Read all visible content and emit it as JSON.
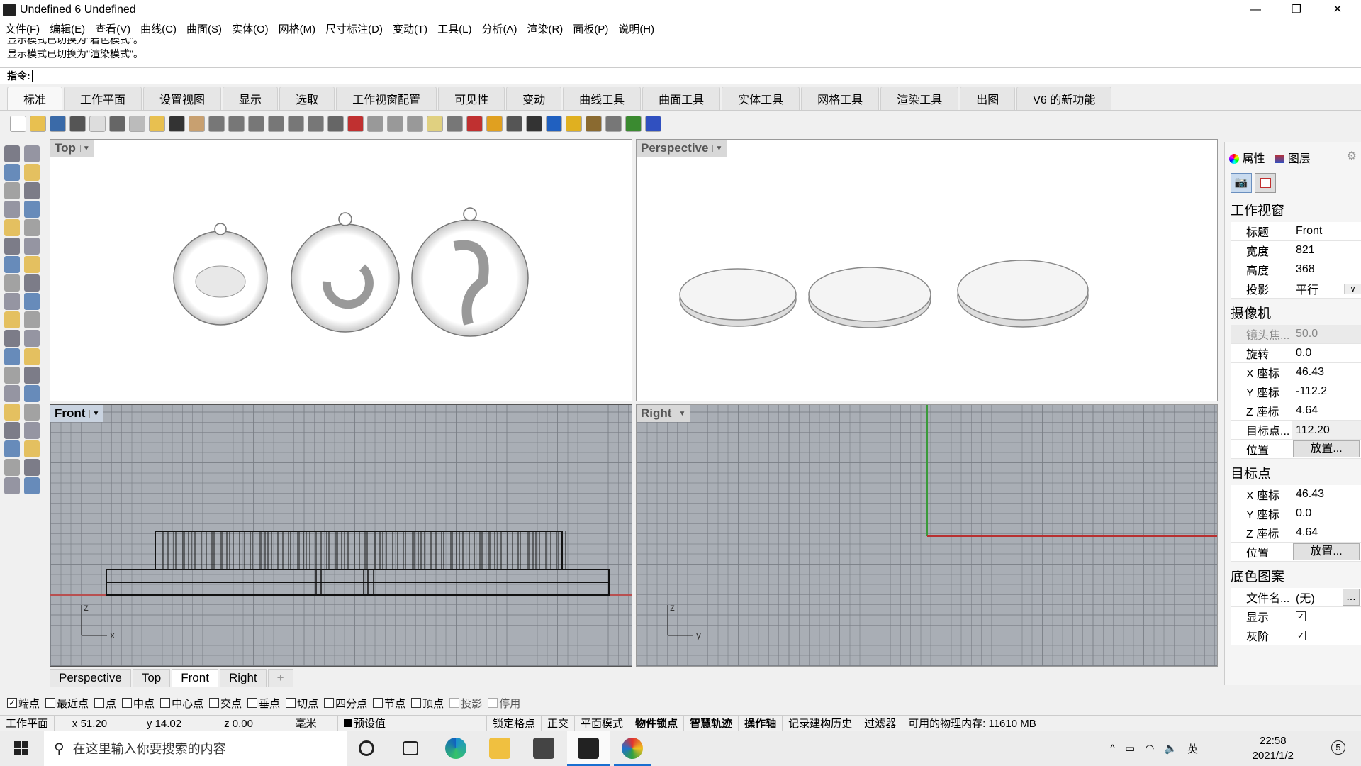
{
  "window": {
    "title": "Undefined 6 Undefined",
    "minimize": "—",
    "restore": "❐",
    "close": "✕"
  },
  "menu": [
    "文件(F)",
    "编辑(E)",
    "查看(V)",
    "曲线(C)",
    "曲面(S)",
    "实体(O)",
    "网格(M)",
    "尺寸标注(D)",
    "变动(T)",
    "工具(L)",
    "分析(A)",
    "渲染(R)",
    "面板(P)",
    "说明(H)"
  ],
  "history": [
    "显示模式已切换为\"着色模式\"。",
    "显示模式已切换为\"渲染模式\"。"
  ],
  "command": {
    "label": "指令:",
    "value": ""
  },
  "tabs": [
    "标准",
    "工作平面",
    "设置视图",
    "显示",
    "选取",
    "工作视窗配置",
    "可见性",
    "变动",
    "曲线工具",
    "曲面工具",
    "实体工具",
    "网格工具",
    "渲染工具",
    "出图",
    "V6 的新功能"
  ],
  "toolbar_colors": [
    "#ffffff",
    "#e8c050",
    "#3a6aa8",
    "#555",
    "#ddd",
    "#666",
    "#bbb",
    "#e8c050",
    "#333",
    "#c8a070",
    "#777",
    "#777",
    "#777",
    "#777",
    "#777",
    "#777",
    "#666",
    "#c03030",
    "#999",
    "#999",
    "#999",
    "#e0d080",
    "#777",
    "#c03030",
    "#e0a020",
    "#555",
    "#333",
    "#2060c0",
    "#e0b020",
    "#8a6a30",
    "#777",
    "#3a8a30",
    "#3050c0"
  ],
  "viewports": {
    "top": "Top",
    "perspective": "Perspective",
    "front": "Front",
    "right": "Right"
  },
  "axes": {
    "front_v": "z",
    "front_h": "x",
    "right_v": "z",
    "right_h": "y"
  },
  "viewport_tabs": [
    "Perspective",
    "Top",
    "Front",
    "Right"
  ],
  "add_tab": "+",
  "osnap": [
    {
      "label": "端点",
      "checked": true
    },
    {
      "label": "最近点",
      "checked": false
    },
    {
      "label": "点",
      "checked": false
    },
    {
      "label": "中点",
      "checked": false
    },
    {
      "label": "中心点",
      "checked": false
    },
    {
      "label": "交点",
      "checked": false
    },
    {
      "label": "垂点",
      "checked": false
    },
    {
      "label": "切点",
      "checked": false
    },
    {
      "label": "四分点",
      "checked": false
    },
    {
      "label": "节点",
      "checked": false
    },
    {
      "label": "顶点",
      "checked": false
    },
    {
      "label": "投影",
      "checked": false,
      "disabled": true
    },
    {
      "label": "停用",
      "checked": false,
      "disabled": true
    }
  ],
  "status": {
    "cplane": "工作平面",
    "x": "x 51.20",
    "y": "y 14.02",
    "z": "z 0.00",
    "unit": "毫米",
    "layer": "预设值",
    "items": [
      {
        "t": "锁定格点",
        "b": false
      },
      {
        "t": "正交",
        "b": false
      },
      {
        "t": "平面模式",
        "b": false
      },
      {
        "t": "物件锁点",
        "b": true
      },
      {
        "t": "智慧轨迹",
        "b": true
      },
      {
        "t": "操作轴",
        "b": true
      },
      {
        "t": "记录建构历史",
        "b": false
      },
      {
        "t": "过滤器",
        "b": false
      }
    ],
    "memory": "可用的物理内存: 11610 MB"
  },
  "taskbar": {
    "search_placeholder": "在这里输入你要搜索的内容",
    "ime": "英",
    "time": "22:58",
    "date": "2021/1/2",
    "notifications": "5"
  },
  "panel": {
    "tab_properties": "属性",
    "tab_layers": "图层",
    "viewport_section": "工作视窗",
    "title_k": "标题",
    "title_v": "Front",
    "width_k": "宽度",
    "width_v": "821",
    "height_k": "高度",
    "height_v": "368",
    "proj_k": "投影",
    "proj_v": "平行",
    "camera_section": "摄像机",
    "lens_k": "镜头焦...",
    "lens_v": "50.0",
    "rot_k": "旋转",
    "rot_v": "0.0",
    "cx_k": "X 座标",
    "cx_v": "46.43",
    "cy_k": "Y 座标",
    "cy_v": "-112.2",
    "cz_k": "Z 座标",
    "cz_v": "4.64",
    "tgt_k": "目标点...",
    "tgt_v": "112.20",
    "pos_k": "位置",
    "place": "放置...",
    "target_section": "目标点",
    "tx_k": "X 座标",
    "tx_v": "46.43",
    "ty_k": "Y 座标",
    "ty_v": "0.0",
    "tz_k": "Z 座标",
    "tz_v": "4.64",
    "wallpaper_section": "底色图案",
    "file_k": "文件名...",
    "file_v": "(无)",
    "browse": "...",
    "show_k": "显示",
    "gray_k": "灰阶",
    "show_checked": true,
    "gray_checked": true
  }
}
